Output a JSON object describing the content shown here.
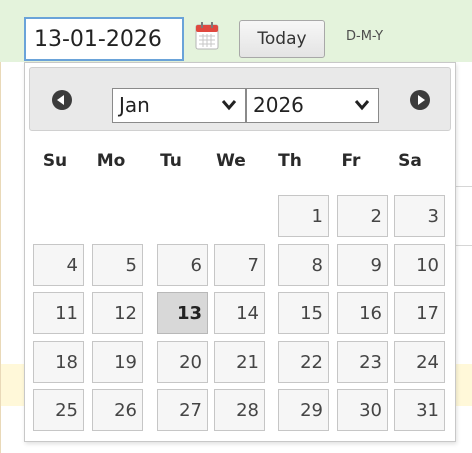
{
  "date_field": {
    "value": "13-01-2026"
  },
  "icons": {
    "calendar": "calendar-icon",
    "prev": "prev-month-icon",
    "next": "next-month-icon",
    "dropdown": "chevron-down-icon"
  },
  "today_button": {
    "label": "Today"
  },
  "format_hint": "D-M-Y",
  "picker": {
    "month_select": {
      "selected": "Jan"
    },
    "year_select": {
      "selected": "2026"
    },
    "weekdays": [
      "Su",
      "Mo",
      "Tu",
      "We",
      "Th",
      "Fr",
      "Sa"
    ],
    "weeks": [
      [
        "",
        "",
        "",
        "",
        "1",
        "2",
        "3"
      ],
      [
        "4",
        "5",
        "6",
        "7",
        "8",
        "9",
        "10"
      ],
      [
        "11",
        "12",
        "13",
        "14",
        "15",
        "16",
        "17"
      ],
      [
        "18",
        "19",
        "20",
        "21",
        "22",
        "23",
        "24"
      ],
      [
        "25",
        "26",
        "27",
        "28",
        "29",
        "30",
        "31"
      ]
    ],
    "selected_day": "13"
  },
  "colors": {
    "background_band": "#e4f3dc",
    "cream_band": "#fff8d9",
    "input_border": "#6aa3d9",
    "header_bg": "#e9e9e9",
    "day_bg": "#f6f6f6",
    "selected_day_bg": "#d8d8d8"
  }
}
